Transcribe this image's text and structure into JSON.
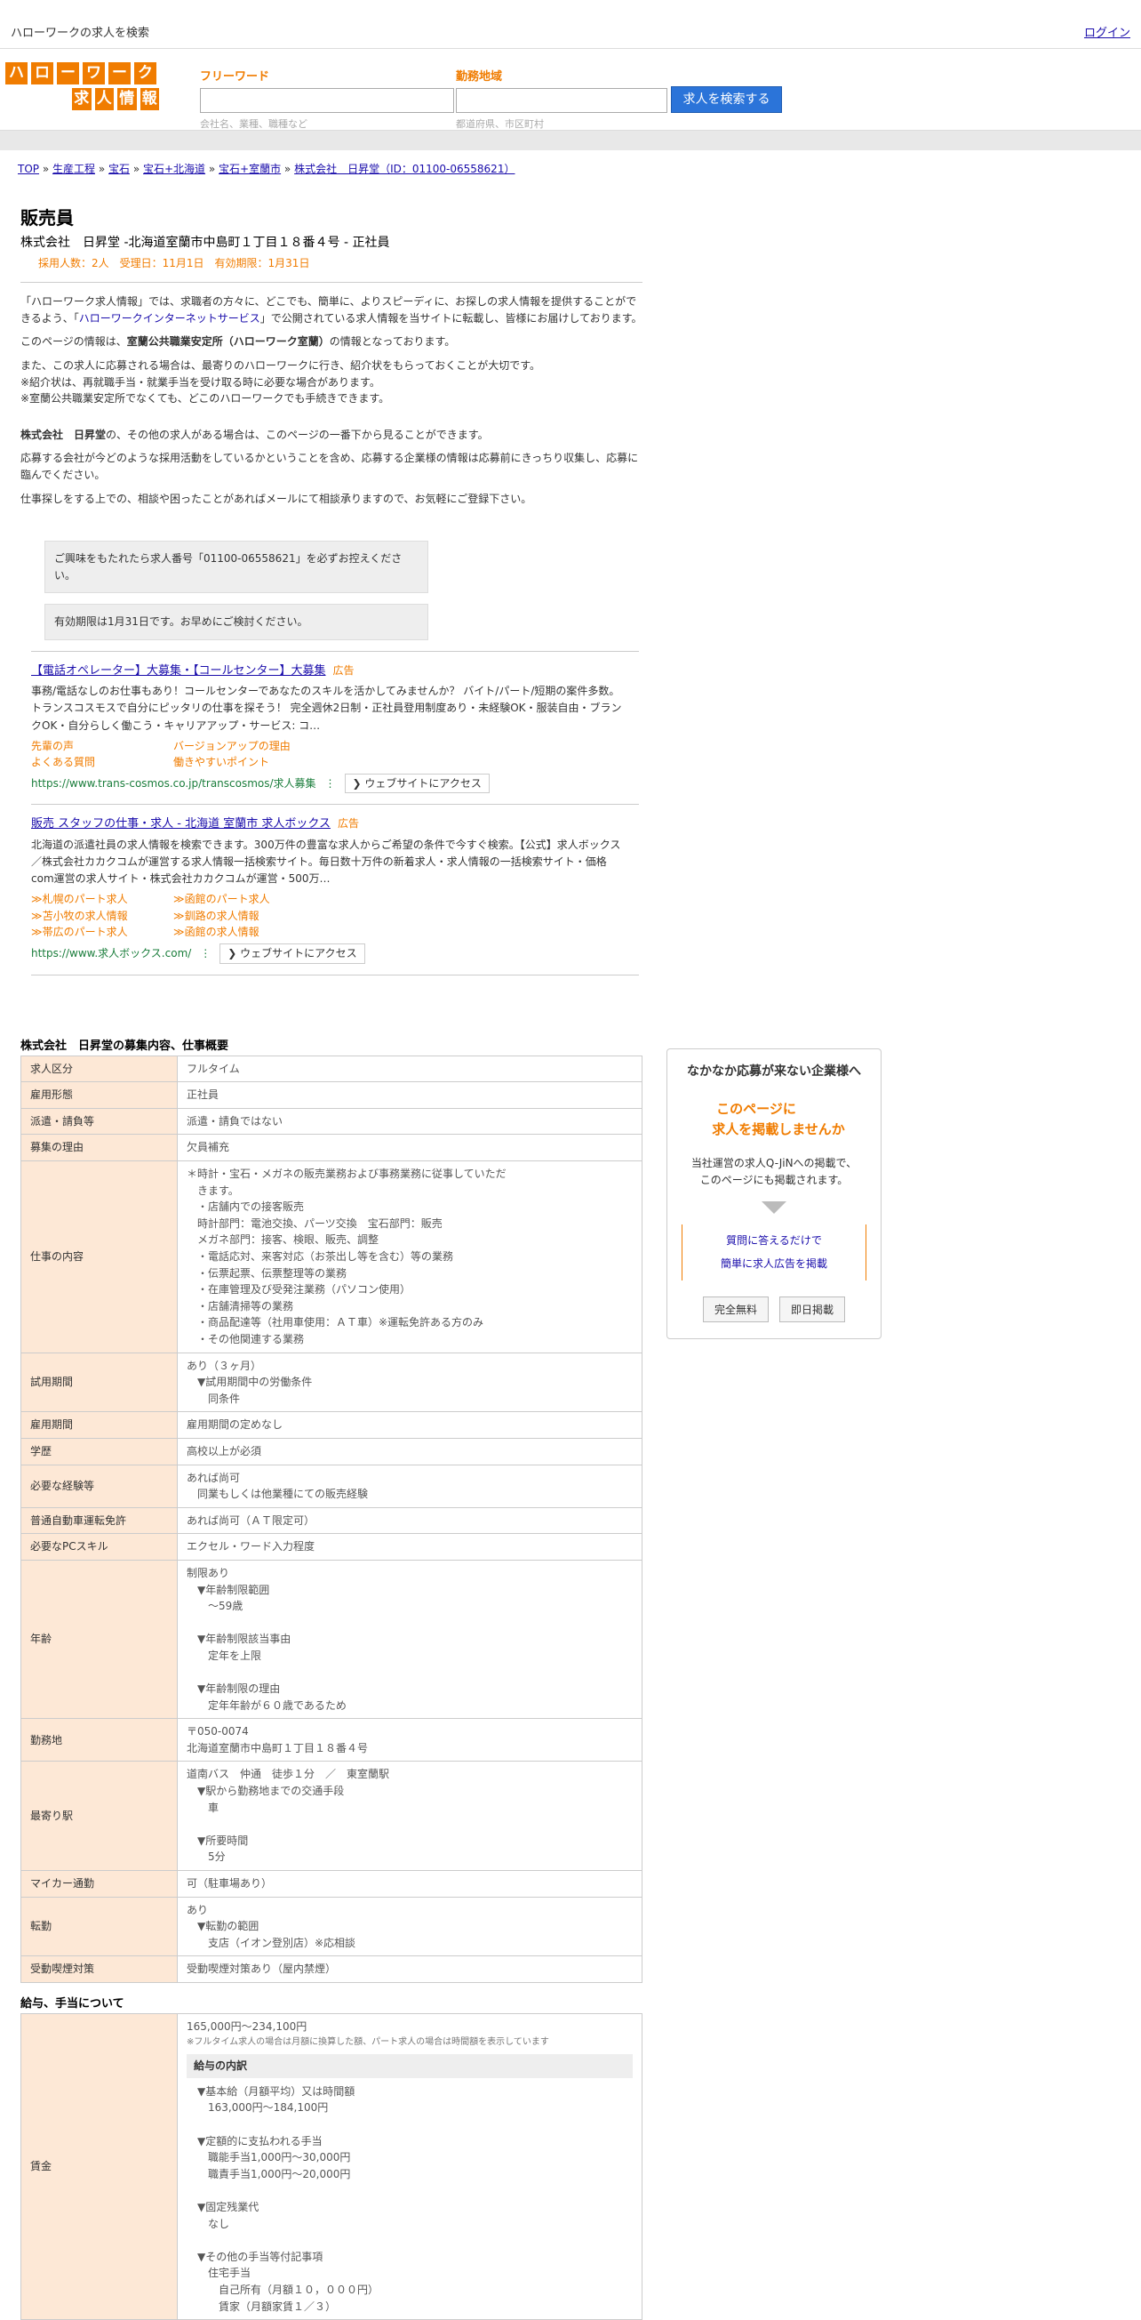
{
  "topbar": {
    "title": "ハローワークの求人を検索",
    "login": "ログイン"
  },
  "logo": {
    "row1": [
      "ハ",
      "ロ",
      "ー",
      "ワ",
      "ー",
      "ク"
    ],
    "row2": [
      "求",
      "人",
      "情",
      "報"
    ]
  },
  "search": {
    "freeword_label": "フリーワード",
    "freeword_placeholder": "会社名、業種、職種など",
    "area_label": "勤務地域",
    "area_placeholder": "都道府県、市区町村",
    "button": "求人を検索する"
  },
  "breadcrumb": [
    "TOP",
    "生産工程",
    "宝石",
    "宝石+北海道",
    "宝石+室蘭市",
    "株式会社　日昇堂（ID：01100-06558621）"
  ],
  "job": {
    "title": "販売員",
    "subtitle": "株式会社　日昇堂 -北海道室蘭市中島町１丁目１８番４号 - 正社員",
    "meta": "採用人数：2人　受理日：11月1日　有効期限：1月31日"
  },
  "intro": {
    "p1a": "「ハローワーク求人情報」では、求職者の方々に、どこでも、簡単に、よりスピーディに、お探しの求人情報を提供することができるよう、「",
    "p1link": "ハローワークインターネットサービス",
    "p1b": "」で公開されている求人情報を当サイトに転載し、皆様にお届けしております。",
    "p2a": "このページの情報は、",
    "p2b": "室蘭公共職業安定所（ハローワーク室蘭）",
    "p2c": "の情報となっております。",
    "p3": "また、この求人に応募される場合は、最寄りのハローワークに行き、紹介状をもらっておくことが大切です。",
    "p4": "※紹介状は、再就職手当・就業手当を受け取る時に必要な場合があります。",
    "p5": "※室蘭公共職業安定所でなくても、どこのハローワークでも手続きできます。",
    "p6a": "株式会社　日昇堂",
    "p6b": "の、その他の求人がある場合は、このページの一番下から見ることができます。",
    "p7": "応募する会社が今どのような採用活動をしているかということを含め、応募する企業様の情報は応募前にきっちり収集し、応募に臨んでください。",
    "p8": "仕事探しをする上での、相談や困ったことがあればメールにて相談承りますので、お気軽にご登録下さい。"
  },
  "notices": [
    "ご興味をもたれたら求人番号「01100-06558621」を必ずお控えください。",
    "有効期限は1月31日です。お早めにご検討ください。"
  ],
  "ads": [
    {
      "title": "【電話オペレーター】大募集・【コールセンター】大募集",
      "tag": "広告",
      "desc": "事務/電話なしのお仕事もあり！コールセンターであなたのスキルを活かしてみませんか？ バイト/パート/短期の案件多数。トランスコスモスで自分にピッタリの仕事を探そう！ 完全週休2日制・正社員登用制度あり・未経験OK・服装自由・ブランクOK・自分らしく働こう・キャリアアップ・サービス: コ…",
      "links": [
        "先輩の声",
        "バージョンアップの理由",
        "よくある質問",
        "働きやすいポイント"
      ],
      "url": "https://www.trans-cosmos.co.jp/transcosmos/求人募集",
      "visit": "❯ ウェブサイトにアクセス"
    },
    {
      "title": "販売 スタッフの仕事・求人 - 北海道 室蘭市 求人ボックス",
      "tag": "広告",
      "desc": "北海道の派遣社員の求人情報を検索できます。300万件の豊富な求人からご希望の条件で今すぐ検索。【公式】求人ボックス／株式会社カカクコムが運営する求人情報一括検索サイト。毎日数十万件の新着求人・求人情報の一括検索サイト・価格com運営の求人サイト・株式会社カカクコムが運営・500万…",
      "links": [
        "≫札幌のパート求人",
        "≫函館のパート求人",
        "≫苫小牧の求人情報",
        "≫釧路の求人情報",
        "≫帯広のパート求人",
        "≫函館の求人情報"
      ],
      "url": "https://www.求人ボックス.com/",
      "visit": "❯ ウェブサイトにアクセス"
    }
  ],
  "summary_title": "株式会社　日昇堂の募集内容、仕事概要",
  "rows": [
    {
      "h": "求人区分",
      "v": [
        "フルタイム"
      ]
    },
    {
      "h": "雇用形態",
      "v": [
        "正社員"
      ]
    },
    {
      "h": "派遣・請負等",
      "v": [
        "派遣・請負ではない"
      ]
    },
    {
      "h": "募集の理由",
      "v": [
        "欠員補充"
      ]
    },
    {
      "h": "仕事の内容",
      "v": [
        "＊時計・宝石・メガネの販売業務および事務業務に従事していただ",
        "　きます。",
        "　・店舗内での接客販売",
        "　時計部門：電池交換、パーツ交換　宝石部門：販売",
        "　メガネ部門：接客、検眼、販売、調整",
        "　・電話応対、来客対応（お茶出し等を含む）等の業務",
        "　・伝票起票、伝票整理等の業務",
        "　・在庫管理及び受発注業務（パソコン使用）",
        "　・店舗清掃等の業務",
        "　・商品配達等（社用車使用：ＡＴ車）※運転免許ある方のみ",
        "　・その他関連する業務"
      ]
    },
    {
      "h": "試用期間",
      "v": [
        "あり（３ヶ月）",
        "　▼試用期間中の労働条件",
        "　　同条件"
      ]
    },
    {
      "h": "雇用期間",
      "v": [
        "雇用期間の定めなし"
      ]
    },
    {
      "h": "学歴",
      "v": [
        "高校以上が必須"
      ]
    },
    {
      "h": "必要な経験等",
      "v": [
        "あれば尚可",
        "　同業もしくは他業種にての販売経験"
      ]
    },
    {
      "h": "普通自動車運転免許",
      "v": [
        "あれば尚可（ＡＴ限定可）"
      ]
    },
    {
      "h": "必要なPCスキル",
      "v": [
        "エクセル・ワード入力程度"
      ]
    },
    {
      "h": "年齢",
      "v": [
        "制限あり",
        "　▼年齢制限範囲",
        "　　〜59歳",
        " ",
        "　▼年齢制限該当事由",
        "　　定年を上限",
        " ",
        "　▼年齢制限の理由",
        "　　定年年齢が６０歳であるため"
      ]
    },
    {
      "h": "勤務地",
      "v": [
        "〒050-0074",
        "北海道室蘭市中島町１丁目１８番４号"
      ]
    },
    {
      "h": "最寄り駅",
      "v": [
        "道南バス　仲通　徒歩１分　／　東室蘭駅",
        "　▼駅から勤務地までの交通手段",
        "　　車",
        " ",
        "　▼所要時間",
        "　　5分"
      ]
    },
    {
      "h": "マイカー通勤",
      "v": [
        "可（駐車場あり）"
      ]
    },
    {
      "h": "転勤",
      "v": [
        "あり",
        "　▼転勤の範囲",
        "　　支店（イオン登別店）※応相談"
      ]
    },
    {
      "h": "受動喫煙対策",
      "v": [
        "受動喫煙対策あり（屋内禁煙）"
      ]
    }
  ],
  "salary_title": "給与、手当について",
  "salary": {
    "h": "賃金",
    "range": "165,000円〜234,100円",
    "note": "※フルタイム求人の場合は月額に換算した額、パート求人の場合は時間額を表示しています",
    "subhead": "給与の内訳",
    "lines": [
      "▼基本給（月額平均）又は時間額",
      "　163,000円〜184,100円",
      " ",
      "▼定額的に支払われる手当",
      "　職能手当1,000円〜30,000円",
      "　職責手当1,000円〜20,000円",
      " ",
      "▼固定残業代",
      "　なし",
      " ",
      "▼その他の手当等付記事項",
      "　住宅手当",
      "　　自己所有（月額１０，０００円）",
      "　　賃家（月額家賃１／３）"
    ]
  },
  "side": {
    "title": "なかなか応募が来ない企業様へ",
    "catch1": "このページに",
    "catch2": "求人を掲載しませんか",
    "body1": "当社運営の求人Q-JiNへの掲載で、",
    "body2": "このページにも掲載されます。",
    "link1": "質問に答えるだけで",
    "link2": "簡単に求人広告を掲載",
    "btn1": "完全無料",
    "btn2": "即日掲載"
  }
}
